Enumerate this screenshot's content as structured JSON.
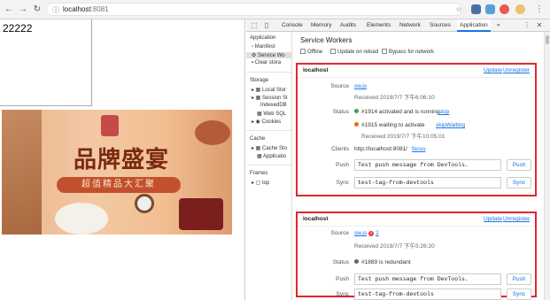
{
  "browser": {
    "url_host": "localhost",
    "url_port": ":8081"
  },
  "page": {
    "counter_text": "22222",
    "banner_title": "品牌盛宴",
    "banner_subtitle": "超值精品大汇聚"
  },
  "devtools": {
    "tabs": [
      "Console",
      "Memory",
      "Audits",
      "Elements",
      "Network",
      "Sources",
      "Application"
    ],
    "active_tab": "Application",
    "more_tabs": "»",
    "sidebar": {
      "application_header": "Application",
      "application_items": [
        "Manifest",
        "Service Wo",
        "Clear stora"
      ],
      "storage_header": "Storage",
      "storage_items": [
        "Local Stor",
        "Session St",
        "IndexedDB",
        "Web SQL",
        "Cookies"
      ],
      "cache_header": "Cache",
      "cache_items": [
        "Cache Sto",
        "Applicatio"
      ],
      "frames_header": "Frames",
      "frames_items": [
        "top"
      ]
    },
    "service_workers": {
      "title": "Service Workers",
      "options": [
        "Offline",
        "Update on reload",
        "Bypass for network"
      ],
      "cards": [
        {
          "host": "localhost",
          "update": "Update",
          "unregister": "Unregister",
          "source_label": "Source",
          "source_file": "sw.js",
          "received": "Received 2019/7/7 下午6:06:10",
          "status_label": "Status",
          "status_active": "#1914 activated and is running",
          "stop": "stop",
          "status_waiting": "#1915 waiting to activate",
          "skip_waiting": "skipWaiting",
          "waiting_received": "Received 2019/7/7 下午10:05:01",
          "clients_label": "Clients",
          "client_url": "http://localhost:8081/",
          "focus": "focus",
          "push_label": "Push",
          "push_value": "Test push message from DevTools.",
          "push_button": "Push",
          "sync_label": "Sync",
          "sync_value": "test-tag-from-devtools",
          "sync_button": "Sync",
          "colors": {
            "active": "#2fa84f",
            "waiting": "#e8710a"
          }
        },
        {
          "host": "localhost",
          "update": "Update",
          "unregister": "Unregister",
          "source_label": "Source",
          "source_file": "sw.js",
          "error_count": "2",
          "received": "Received 2019/7/7 下午5:26:20",
          "status_label": "Status",
          "status_text": "#1889 is redundant",
          "push_label": "Push",
          "push_value": "Test push message from DevTools.",
          "push_button": "Push",
          "sync_label": "Sync",
          "sync_value": "test-tag-from-devtools",
          "sync_button": "Sync",
          "colors": {
            "redundant": "#666666"
          }
        }
      ]
    }
  }
}
